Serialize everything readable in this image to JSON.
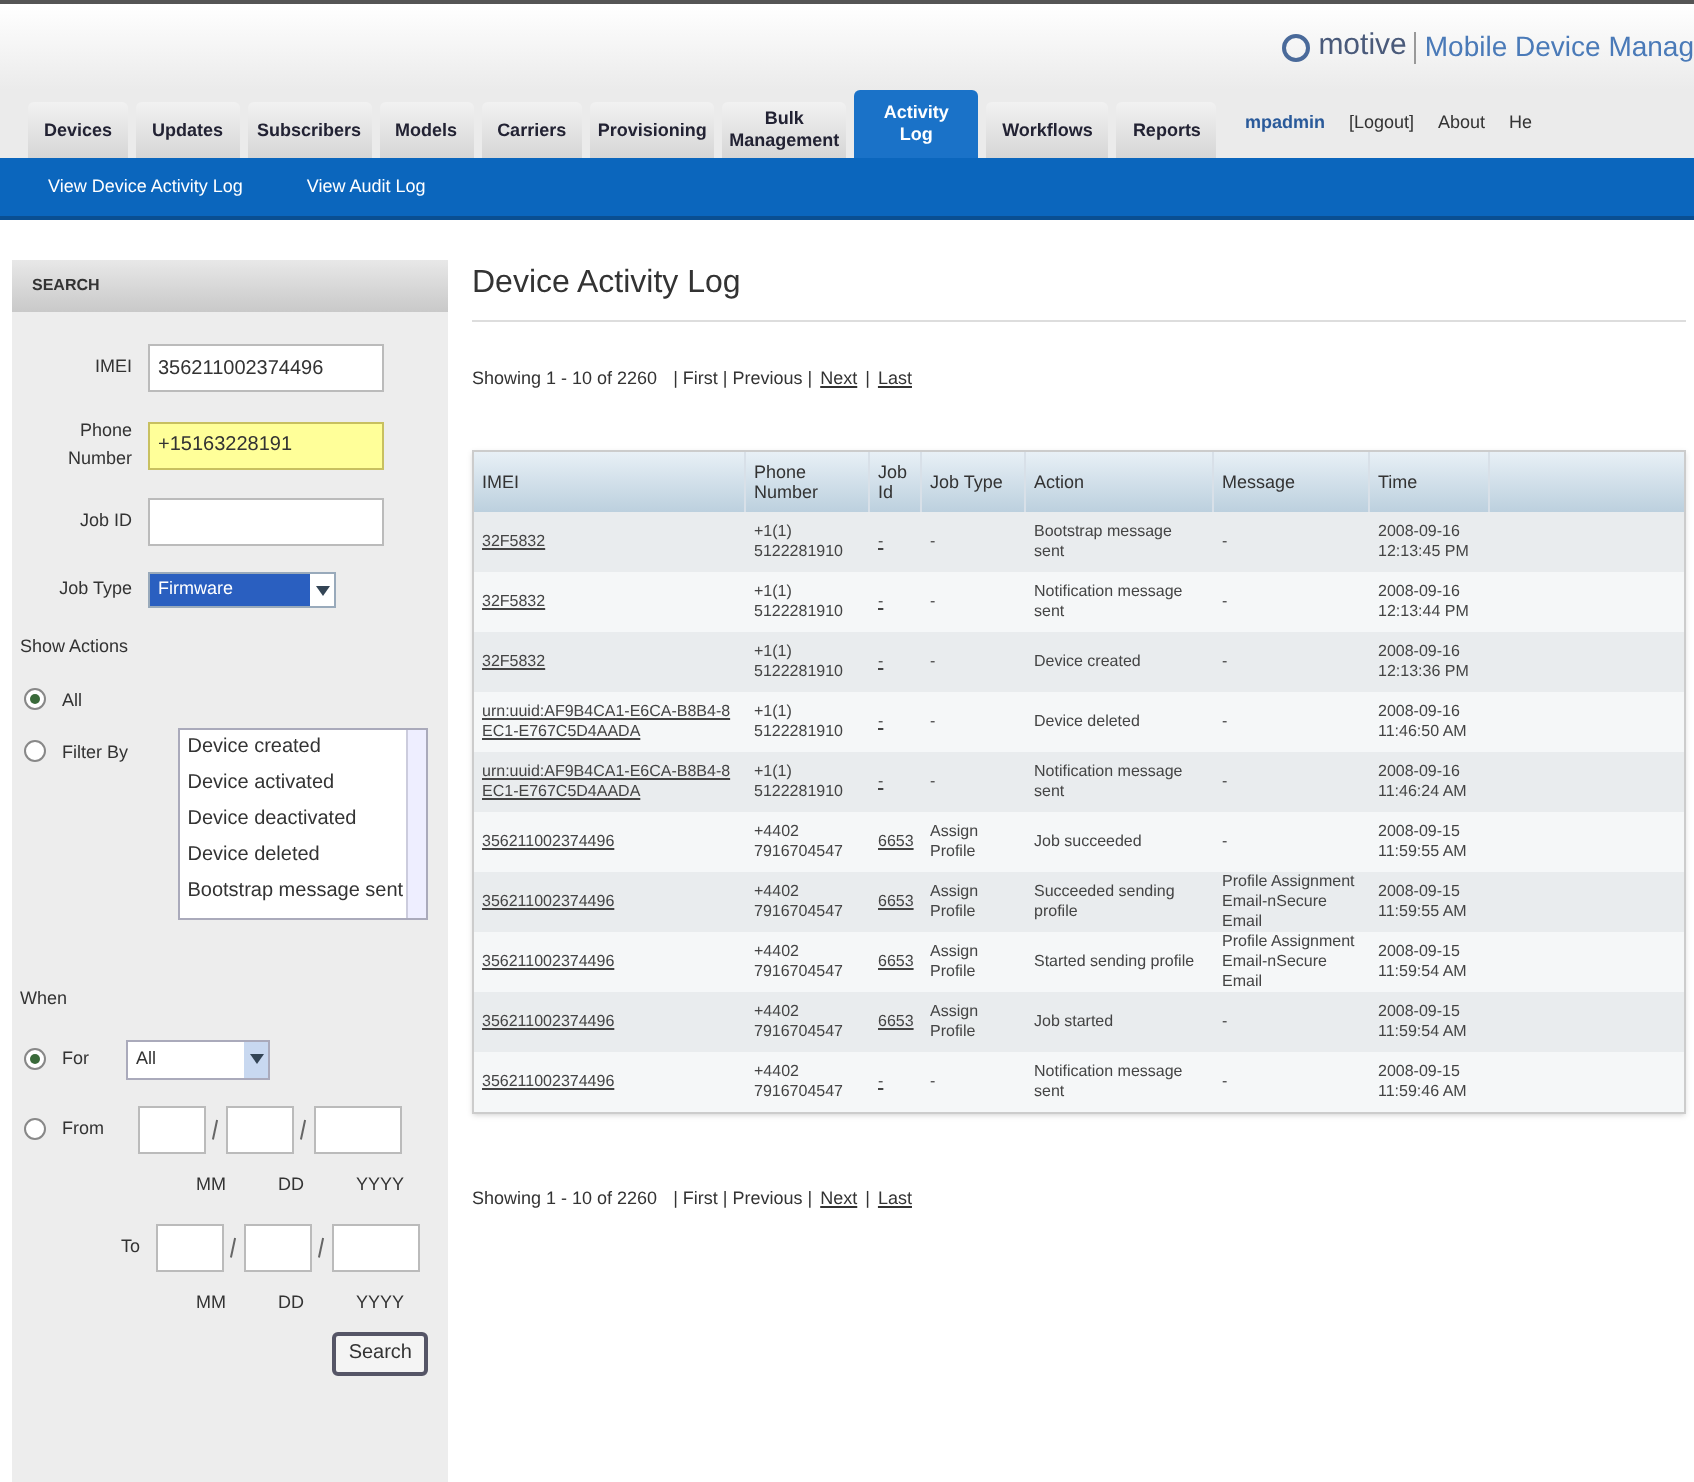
{
  "header": {
    "logo": "motive",
    "product": "Mobile Device Manag",
    "user": "mpadmin",
    "links": [
      "[Logout]",
      "About",
      "He"
    ]
  },
  "tabs": [
    {
      "label": "Devices",
      "selected": false
    },
    {
      "label": "Updates",
      "selected": false
    },
    {
      "label": "Subscribers",
      "selected": false
    },
    {
      "label": "Models",
      "selected": false
    },
    {
      "label": "Carriers",
      "selected": false
    },
    {
      "label": "Provisioning",
      "selected": false
    },
    {
      "label": "Bulk Management",
      "selected": false
    },
    {
      "label": "Activity Log",
      "selected": true
    },
    {
      "label": "Workflows",
      "selected": false
    },
    {
      "label": "Reports",
      "selected": false
    }
  ],
  "subnav": [
    "View Device Activity Log",
    "View Audit Log"
  ],
  "search": {
    "title": "SEARCH",
    "fields": [
      {
        "label": "IMEI",
        "value": "356211002374496",
        "highlighted": false
      },
      {
        "label": "Phone Number",
        "value": "+15163228191",
        "highlighted": true
      },
      {
        "label": "Job ID",
        "highlighted": false
      }
    ],
    "job_type": {
      "label": "Job Type",
      "value": "Firmware"
    },
    "show_actions": {
      "label": "Show Actions",
      "options": [
        {
          "label": "All",
          "selected": true
        },
        {
          "label": "Filter By",
          "selected": false
        }
      ],
      "list": [
        "Device created",
        "Device activated",
        "Device deactivated",
        "Device deleted",
        "Bootstrap message sent"
      ]
    },
    "when": {
      "label": "When",
      "for": {
        "label": "For",
        "value": "All",
        "selected": true
      },
      "from": {
        "label": "From",
        "selected": false
      },
      "to_label": "To",
      "from_date_labels": [
        "MM",
        "DD",
        "YYYY"
      ],
      "to_date_labels": [
        "MM",
        "DD",
        "YYYY"
      ]
    },
    "button": "Search"
  },
  "main": {
    "title": "Device Activity Log",
    "pagination": [
      {
        "showing": "Showing 1 - 10 of 2260",
        "first": "| First | Previous |",
        "next": "Next",
        "sep": "|",
        "last": "Last"
      },
      {
        "showing": "Showing 1 - 10 of 2260",
        "first": "| First | Previous |",
        "next": "Next",
        "sep": "|",
        "last": "Last"
      }
    ],
    "columns": [
      "IMEI",
      "Phone Number",
      "Job Id",
      "Job Type",
      "Action",
      "Message",
      "Time"
    ],
    "rows": [
      {
        "imei": "32F5832",
        "phone": "+1(1) 5122281910",
        "job_id": "-",
        "job_type": "-",
        "action": "Bootstrap message sent",
        "message": "-",
        "time": "2008-09-16 12:13:45 PM"
      },
      {
        "imei": "32F5832",
        "phone": "+1(1) 5122281910",
        "job_id": "-",
        "job_type": "-",
        "action": "Notification message sent",
        "message": "-",
        "time": "2008-09-16 12:13:44 PM"
      },
      {
        "imei": "32F5832",
        "phone": "+1(1) 5122281910",
        "job_id": "-",
        "job_type": "-",
        "action": "Device created",
        "message": "-",
        "time": "2008-09-16 12:13:36 PM"
      },
      {
        "imei": "urn:uuid:AF9B4CA1-E6CA-B8B4-8EC1-E767C5D4AADA",
        "phone": "+1(1) 5122281910",
        "job_id": "-",
        "job_type": "-",
        "action": "Device deleted",
        "message": "-",
        "time": "2008-09-16 11:46:50 AM"
      },
      {
        "imei": "urn:uuid:AF9B4CA1-E6CA-B8B4-8EC1-E767C5D4AADA",
        "phone": "+1(1) 5122281910",
        "job_id": "-",
        "job_type": "-",
        "action": "Notification message sent",
        "message": "-",
        "time": "2008-09-16 11:46:24 AM"
      },
      {
        "imei": "356211002374496",
        "phone": "+4402 7916704547",
        "job_id": "6653",
        "job_type": "Assign Profile",
        "action": "Job succeeded",
        "message": "-",
        "time": "2008-09-15 11:59:55 AM"
      },
      {
        "imei": "356211002374496",
        "phone": "+4402 7916704547",
        "job_id": "6653",
        "job_type": "Assign Profile",
        "action": "Succeeded sending profile",
        "message": "Profile Assignment Email-nSecure Email",
        "time": "2008-09-15 11:59:55 AM"
      },
      {
        "imei": "356211002374496",
        "phone": "+4402 7916704547",
        "job_id": "6653",
        "job_type": "Assign Profile",
        "action": "Started sending profile",
        "message": "Profile Assignment Email-nSecure Email",
        "time": "2008-09-15 11:59:54 AM"
      },
      {
        "imei": "356211002374496",
        "phone": "+4402 7916704547",
        "job_id": "6653",
        "job_type": "Assign Profile",
        "action": "Job started",
        "message": "-",
        "time": "2008-09-15 11:59:54 AM"
      },
      {
        "imei": "356211002374496",
        "phone": "+4402 7916704547",
        "job_id": "-",
        "job_type": "-",
        "action": "Notification message sent",
        "message": "-",
        "time": "2008-09-15 11:59:46 AM"
      }
    ]
  }
}
